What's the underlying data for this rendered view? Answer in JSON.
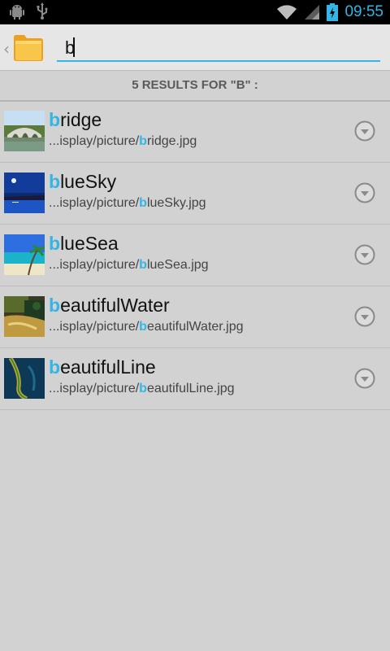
{
  "status_bar": {
    "time": "09:55",
    "icons": [
      "android-debug-icon",
      "usb-icon",
      "wifi-icon",
      "signal-icon",
      "battery-charging-icon"
    ]
  },
  "search": {
    "query": "b",
    "back_icon": "chevron-left-icon",
    "app_icon": "folder-icon"
  },
  "results_header": "5 RESULTS FOR \"B\" :",
  "colors": {
    "accent": "#33b5e5",
    "background": "#d2d2d2",
    "status_bar": "#000000"
  },
  "results": [
    {
      "title_match": "b",
      "title_rest": "ridge",
      "path_prefix": "...isplay/picture/",
      "path_match": "b",
      "path_rest": "ridge.jpg",
      "thumb": "bridge-thumbnail"
    },
    {
      "title_match": "b",
      "title_rest": "lueSky",
      "path_prefix": "...isplay/picture/",
      "path_match": "b",
      "path_rest": "lueSky.jpg",
      "thumb": "blue-sky-thumbnail"
    },
    {
      "title_match": "b",
      "title_rest": "lueSea",
      "path_prefix": "...isplay/picture/",
      "path_match": "b",
      "path_rest": "lueSea.jpg",
      "thumb": "blue-sea-thumbnail"
    },
    {
      "title_match": "b",
      "title_rest": "eautifulWater",
      "path_prefix": "...isplay/picture/",
      "path_match": "b",
      "path_rest": "eautifulWater.jpg",
      "thumb": "beautiful-water-thumbnail"
    },
    {
      "title_match": "b",
      "title_rest": "eautifulLine",
      "path_prefix": "...isplay/picture/",
      "path_match": "b",
      "path_rest": "eautifulLine.jpg",
      "thumb": "beautiful-line-thumbnail"
    }
  ]
}
